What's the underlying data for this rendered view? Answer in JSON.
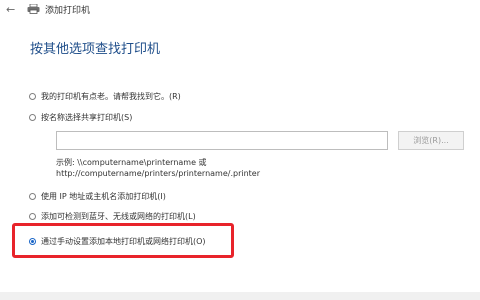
{
  "window": {
    "title": "添加打印机"
  },
  "page": {
    "title": "按其他选项查找打印机"
  },
  "options": [
    {
      "label": "我的打印机有点老。请帮我找到它。(R)",
      "checked": false
    },
    {
      "label": "按名称选择共享打印机(S)",
      "checked": false
    },
    {
      "label": "使用 IP 地址或主机名添加打印机(I)",
      "checked": false
    },
    {
      "label": "添加可检测到蓝牙、无线或网络的打印机(L)",
      "checked": false
    },
    {
      "label": "通过手动设置添加本地打印机或网络打印机(O)",
      "checked": true
    }
  ],
  "share": {
    "value": "",
    "browse_label": "浏览(R)..."
  },
  "example": {
    "line1": "示例: \\\\computername\\printername 或",
    "line2": "http://computername/printers/printername/.printer"
  },
  "colors": {
    "title_blue": "#1f4e8a",
    "radio_blue": "#1a66c8",
    "highlight_red": "#e8232a"
  }
}
